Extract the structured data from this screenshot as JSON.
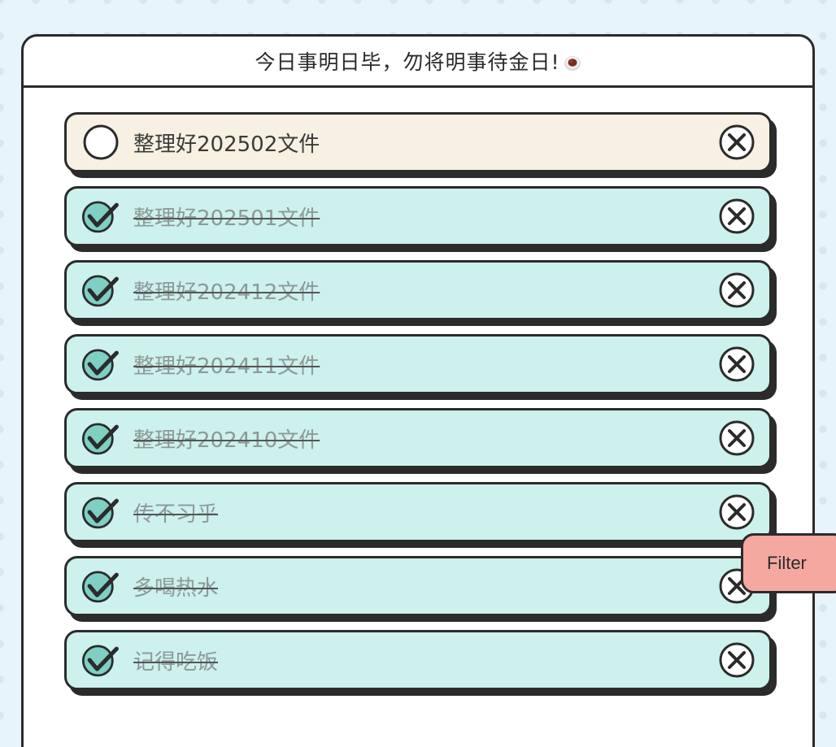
{
  "header": {
    "title": "今日事明日毕，勿将明事待金日!",
    "title_icon": "coffee-cup-icon"
  },
  "todos": [
    {
      "text": "整理好202502文件",
      "done": false
    },
    {
      "text": "整理好202501文件",
      "done": true
    },
    {
      "text": "整理好202412文件",
      "done": true
    },
    {
      "text": "整理好202411文件",
      "done": true
    },
    {
      "text": "整理好202410文件",
      "done": true
    },
    {
      "text": "传不习乎",
      "done": true
    },
    {
      "text": "多喝热水",
      "done": true
    },
    {
      "text": "记得吃饭",
      "done": true
    }
  ],
  "filter": {
    "label": "Filter"
  },
  "colors": {
    "page_background": "#e8f4fb",
    "done_item": "#cdf1ec",
    "pending_item": "#f7f0e3",
    "check_fill": "#7fcfc3",
    "filter_button": "#f5a8a0",
    "border": "#2b2b2b"
  },
  "icons": {
    "checked": "checkmark-circle-icon",
    "unchecked": "empty-circle-icon",
    "delete": "close-circle-icon"
  }
}
